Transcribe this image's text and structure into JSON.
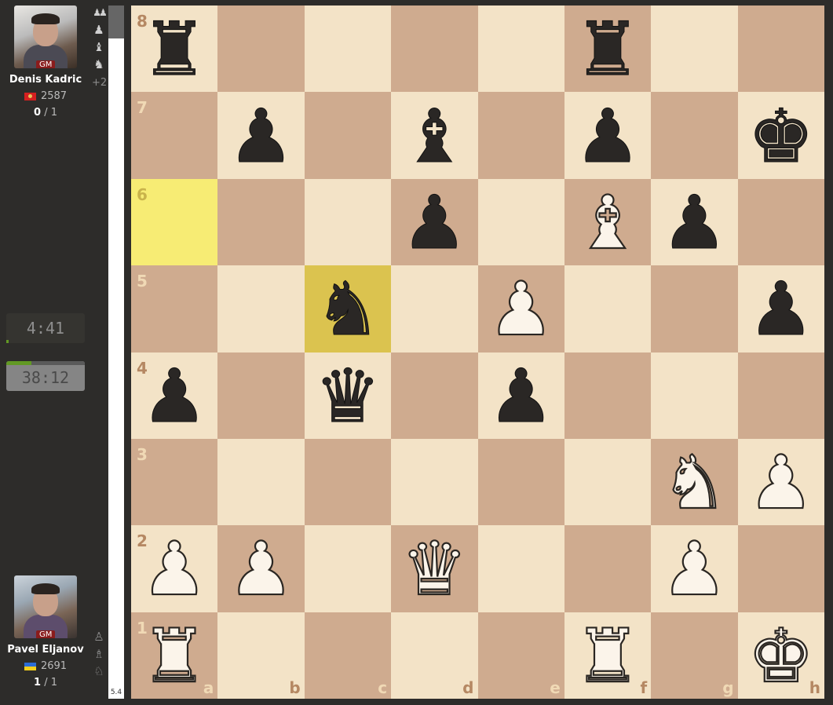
{
  "top_player": {
    "name": "Denis Kadric",
    "title": "GM",
    "rating": "2587",
    "score": "0",
    "score_total": " / 1",
    "captured": [
      "♟♟",
      "♟",
      "♝",
      "♞"
    ],
    "material": "+2"
  },
  "bottom_player": {
    "name": "Pavel Eljanov",
    "title": "GM",
    "rating": "2691",
    "score": "1",
    "score_total": " / 1",
    "captured": [
      "♙",
      "♗",
      "♘"
    ]
  },
  "clocks": {
    "top": "4:41",
    "bottom": "38:12"
  },
  "eval": {
    "value": "5.4"
  },
  "board": {
    "ranks": [
      [
        "r",
        "",
        "",
        "",
        "",
        "r",
        "",
        ""
      ],
      [
        "",
        "p",
        "",
        "b",
        "",
        "p",
        "",
        "k"
      ],
      [
        "",
        "",
        "",
        "p",
        "",
        "B",
        "p",
        ""
      ],
      [
        "",
        "",
        "n",
        "",
        "P",
        "",
        "",
        "p"
      ],
      [
        "p",
        "",
        "q",
        "",
        "p",
        "",
        "",
        ""
      ],
      [
        "",
        "",
        "",
        "",
        "",
        "",
        "N",
        "P"
      ],
      [
        "P",
        "P",
        "",
        "Q",
        "",
        "",
        "P",
        ""
      ],
      [
        "R",
        "",
        "",
        "",
        "",
        "R",
        "",
        "K"
      ]
    ],
    "highlight": [
      "a6",
      "c5"
    ],
    "rank_labels": [
      "8",
      "7",
      "6",
      "5",
      "4",
      "3",
      "2",
      "1"
    ],
    "file_labels": [
      "a",
      "b",
      "c",
      "d",
      "e",
      "f",
      "g",
      "h"
    ]
  }
}
